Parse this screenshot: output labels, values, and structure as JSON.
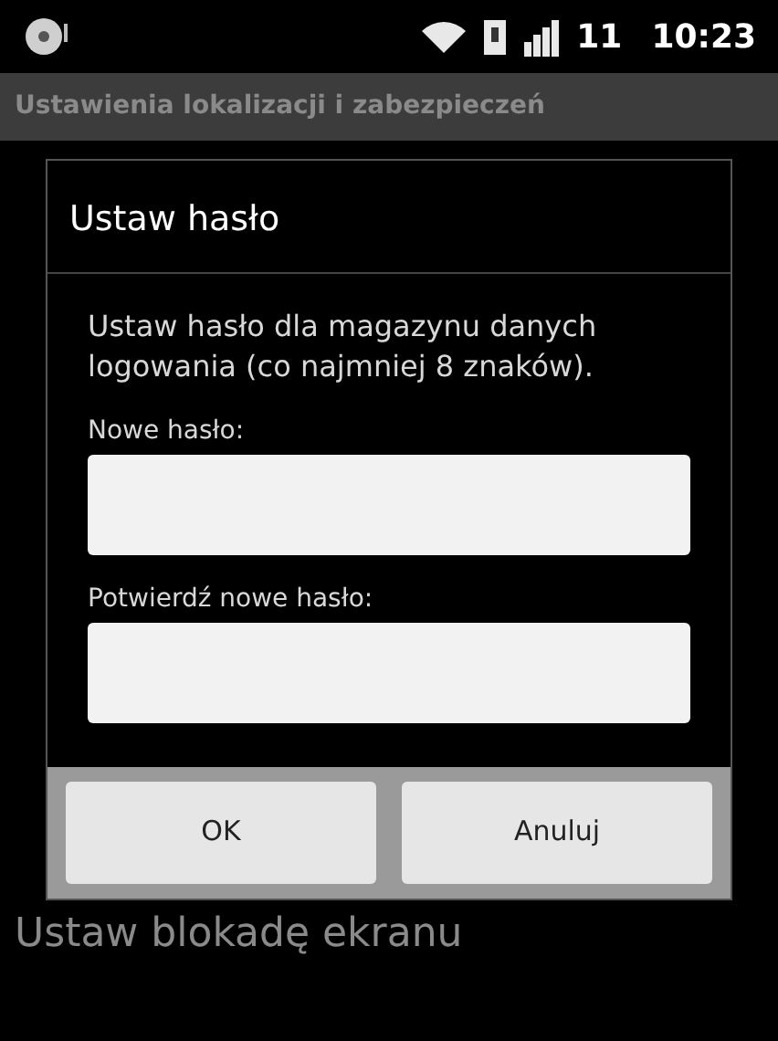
{
  "status_bar": {
    "signal_label": "11",
    "time": "10:23"
  },
  "title_bar": {
    "title": "Ustawienia lokalizacji i zabezpieczeń"
  },
  "dialog": {
    "title": "Ustaw hasło",
    "message": "Ustaw hasło dla magazynu danych logowania (co najmniej 8 znaków).",
    "fields": [
      {
        "label": "Nowe hasło:"
      },
      {
        "label": "Potwierdź nowe hasło:"
      }
    ],
    "buttons": [
      {
        "label": "OK"
      },
      {
        "label": "Anuluj"
      }
    ]
  },
  "settings_list": {
    "items": [
      {
        "title": "Ustaw blokadę ekranu"
      }
    ]
  }
}
